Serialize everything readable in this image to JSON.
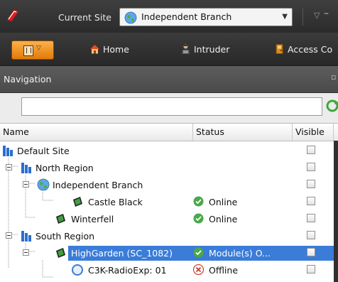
{
  "titlebar": {
    "site_label": "Current Site",
    "site_value": "Independent Branch"
  },
  "ribbon": {
    "tabs": [
      {
        "label": "Home",
        "icon": "home-icon"
      },
      {
        "label": "Intruder",
        "icon": "intruder-icon"
      },
      {
        "label": "Access Co",
        "icon": "access-control-icon"
      }
    ]
  },
  "navigation": {
    "title": "Navigation",
    "search_value": "",
    "columns": {
      "name": "Name",
      "status": "Status",
      "visible": "Visible"
    },
    "rows": [
      {
        "label": "Default Site",
        "icon": "site-icon",
        "status": "",
        "status_icon": ""
      },
      {
        "label": "North Region",
        "icon": "region-icon",
        "status": "",
        "status_icon": ""
      },
      {
        "label": "Independent Branch",
        "icon": "globe-icon",
        "status": "",
        "status_icon": ""
      },
      {
        "label": "Castle Black",
        "icon": "controller-icon",
        "status": "Online",
        "status_icon": "online-check-icon"
      },
      {
        "label": "Winterfell",
        "icon": "controller-icon",
        "status": "Online",
        "status_icon": "online-check-icon"
      },
      {
        "label": "South Region",
        "icon": "region-icon",
        "status": "",
        "status_icon": ""
      },
      {
        "label": "HighGarden (SC_1082)",
        "icon": "controller-icon",
        "status": "Module(s) O...",
        "status_icon": "online-check-icon"
      },
      {
        "label": "C3K-RadioExp: 01",
        "icon": "radio-expander-icon",
        "status": "Offline",
        "status_icon": "offline-x-icon"
      }
    ]
  },
  "colors": {
    "selection": "#3a7cd8",
    "online": "#4aa84a",
    "offline": "#d23a2a",
    "accent": "#f39a1f"
  }
}
